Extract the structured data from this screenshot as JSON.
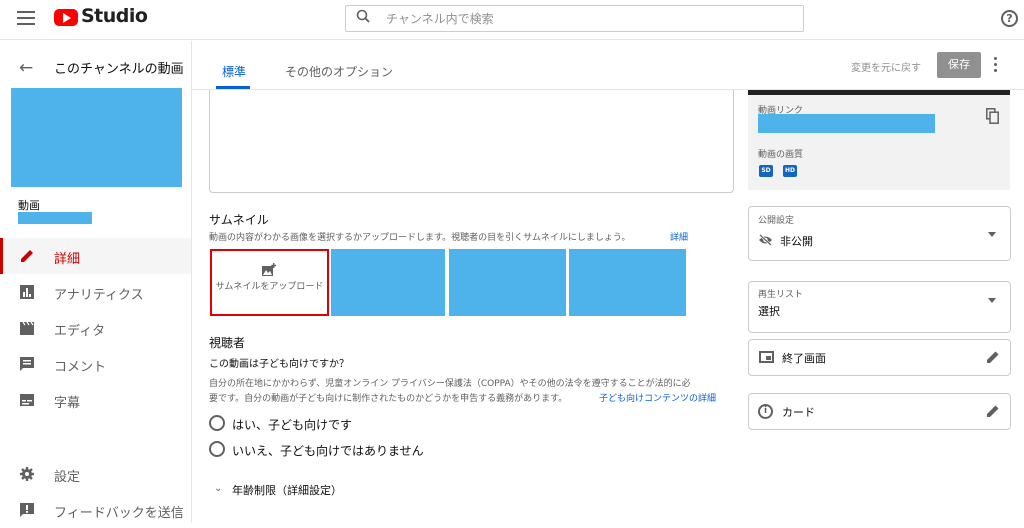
{
  "header": {
    "logo_text": "Studio",
    "search_placeholder": "チャンネル内で検索",
    "help_glyph": "?"
  },
  "sidebar": {
    "back_label": "このチャンネルの動画",
    "video_label": "動画",
    "items": [
      {
        "label": "詳細",
        "icon": "pencil-icon",
        "active": true
      },
      {
        "label": "アナリティクス",
        "icon": "analytics-icon"
      },
      {
        "label": "エディタ",
        "icon": "clapper-icon"
      },
      {
        "label": "コメント",
        "icon": "comment-icon"
      },
      {
        "label": "字幕",
        "icon": "subtitles-icon"
      },
      {
        "label": "設定",
        "icon": "gear-icon"
      },
      {
        "label": "フィードバックを送信",
        "icon": "feedback-icon"
      }
    ]
  },
  "toolbar": {
    "tabs": [
      {
        "label": "標準",
        "active": true
      },
      {
        "label": "その他のオプション"
      }
    ],
    "undo_label": "変更を元に戻す",
    "save_label": "保存"
  },
  "thumbnail": {
    "title": "サムネイル",
    "description": "動画の内容がわかる画像を選択するかアップロードします。視聴者の目を引くサムネイルにしましょう。",
    "detail_link": "詳細",
    "upload_label": "サムネイルをアップロード"
  },
  "audience": {
    "title": "視聴者",
    "question": "この動画は子ども向けですか？",
    "body_line1": "自分の所在地にかかわらず、児童オンライン プライバシー保護法（COPPA）やその他の法令を遵守することが法的に必",
    "body_line2": "要です。自分の動画が子ども向けに制作されたものかどうかを申告する義務があります。",
    "link": "子ども向けコンテンツの詳細",
    "option_yes": "はい、子ども向けです",
    "option_no": "いいえ、子ども向けではありません",
    "age_restriction": "年齢制限（詳細設定）"
  },
  "right_panel": {
    "link_label": "動画リンク",
    "quality_label": "動画の画質",
    "quality_badges": [
      "SD",
      "HD"
    ],
    "visibility_label": "公開設定",
    "visibility_value": "非公開",
    "playlist_label": "再生リスト",
    "playlist_value": "選択",
    "end_screen_label": "終了画面",
    "cards_label": "カード",
    "cards_icon_glyph": "i"
  },
  "colors": {
    "accent_blue": "#065fd4",
    "active_red": "#cc0000",
    "placeholder_blue": "#4eb3ea",
    "highlight_red": "#e00000"
  }
}
